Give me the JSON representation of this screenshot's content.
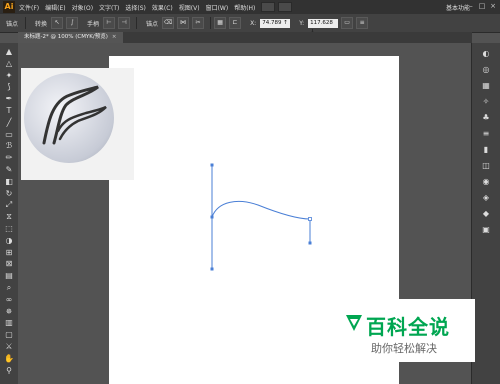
{
  "app": {
    "logo": "Ai",
    "workspace": "基本功能",
    "window_controls": [
      "minimize-icon",
      "maximize-icon",
      "close-icon"
    ]
  },
  "menubar": {
    "items": [
      "文件(F)",
      "编辑(E)",
      "对象(O)",
      "文字(T)",
      "选择(S)",
      "效果(C)",
      "视图(V)",
      "窗口(W)",
      "帮助(H)"
    ]
  },
  "options": {
    "anchor_label": "锚点",
    "convert_label": "转换",
    "handle_label": "手柄",
    "anchor2_label": "锚点",
    "x_value": "74.789 ↑",
    "y_value": "117.628 ↓",
    "x_label": "X:",
    "y_label": "Y:"
  },
  "document": {
    "tab_title": "未标题-2* @ 100% (CMYK/预览)",
    "close": "×"
  },
  "watermark": {
    "title": "百科全说",
    "subtitle": "助你轻松解决"
  },
  "icons": {
    "tools": [
      "selection-icon",
      "direct-selection-icon",
      "magic-wand-icon",
      "lasso-icon",
      "pen-icon",
      "type-icon",
      "line-icon",
      "rectangle-icon",
      "paintbrush-icon",
      "pencil-icon",
      "blob-brush-icon",
      "eraser-icon",
      "rotate-icon",
      "scale-icon",
      "width-icon",
      "free-transform-icon",
      "shape-builder-icon",
      "perspective-icon",
      "mesh-icon",
      "gradient-icon",
      "eyedropper-icon",
      "blend-icon",
      "symbol-sprayer-icon",
      "graph-icon",
      "artboard-icon",
      "slice-icon",
      "hand-icon",
      "zoom-icon"
    ],
    "panels": [
      "color-icon",
      "color-guide-icon",
      "swatches-icon",
      "brushes-icon",
      "symbols-icon",
      "stroke-icon",
      "gradient-panel-icon",
      "transparency-icon",
      "appearance-icon",
      "graphic-styles-icon",
      "layers-icon",
      "artboards-icon"
    ]
  },
  "colors": {
    "path_stroke": "#4a7fd6",
    "watermark_green": "#00a651"
  }
}
